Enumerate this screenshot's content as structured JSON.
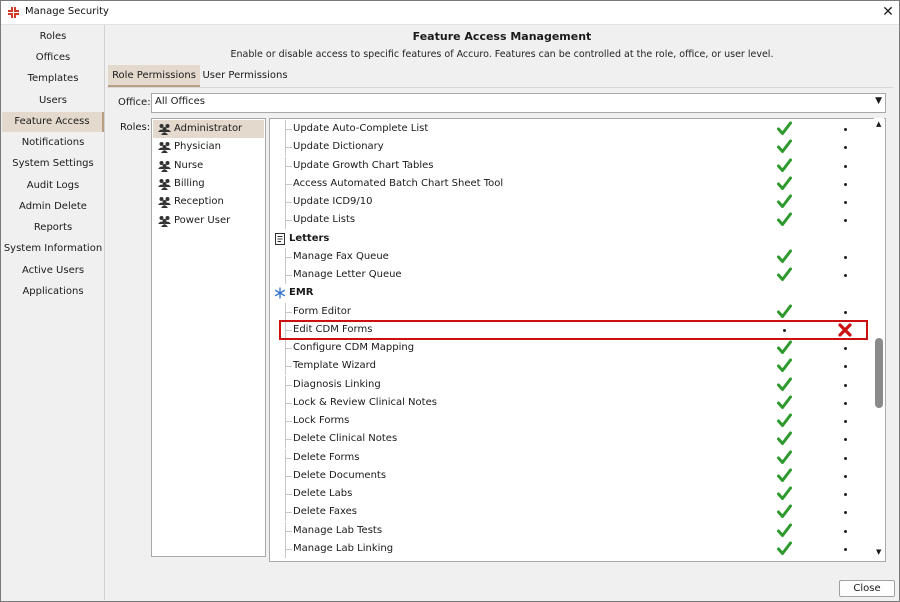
{
  "window": {
    "title": "Manage Security"
  },
  "sidebar": {
    "items": [
      {
        "label": "Roles"
      },
      {
        "label": "Offices"
      },
      {
        "label": "Templates"
      },
      {
        "label": "Users"
      },
      {
        "label": "Feature Access",
        "active": true
      },
      {
        "label": "Notifications"
      },
      {
        "label": "System Settings"
      },
      {
        "label": "Audit Logs"
      },
      {
        "label": "Admin Delete"
      },
      {
        "label": "Reports"
      },
      {
        "label": "System Information"
      },
      {
        "label": "Active Users"
      },
      {
        "label": "Applications"
      }
    ]
  },
  "header": {
    "title": "Feature Access Management",
    "description": "Enable or disable access to specific features of Accuro. Features can be controlled at the role, office, or user level."
  },
  "tabs": [
    {
      "label": "Role Permissions",
      "active": true
    },
    {
      "label": "User Permissions"
    }
  ],
  "office": {
    "label": "Office:",
    "value": "All Offices"
  },
  "roles": {
    "label": "Roles:",
    "items": [
      {
        "label": "Administrator",
        "selected": true
      },
      {
        "label": "Physician"
      },
      {
        "label": "Nurse"
      },
      {
        "label": "Billing"
      },
      {
        "label": "Reception"
      },
      {
        "label": "Power User"
      }
    ]
  },
  "features": [
    {
      "type": "item",
      "label": "Update Auto-Complete List",
      "allowed": true
    },
    {
      "type": "item",
      "label": "Update Dictionary",
      "allowed": true
    },
    {
      "type": "item",
      "label": "Update Growth Chart Tables",
      "allowed": true
    },
    {
      "type": "item",
      "label": "Access Automated Batch Chart Sheet Tool",
      "allowed": true
    },
    {
      "type": "item",
      "label": "Update ICD9/10",
      "allowed": true
    },
    {
      "type": "item",
      "label": "Update Lists",
      "allowed": true
    },
    {
      "type": "category",
      "label": "Letters",
      "icon": "letter-icon"
    },
    {
      "type": "item",
      "label": "Manage Fax Queue",
      "allowed": true
    },
    {
      "type": "item",
      "label": "Manage Letter Queue",
      "allowed": true
    },
    {
      "type": "category",
      "label": "EMR",
      "icon": "snowflake-icon"
    },
    {
      "type": "item",
      "label": "Form Editor",
      "allowed": true
    },
    {
      "type": "item",
      "label": "Edit CDM Forms",
      "allowed": false,
      "highlighted": true
    },
    {
      "type": "item",
      "label": "Configure CDM Mapping",
      "allowed": true
    },
    {
      "type": "item",
      "label": "Template Wizard",
      "allowed": true
    },
    {
      "type": "item",
      "label": "Diagnosis Linking",
      "allowed": true
    },
    {
      "type": "item",
      "label": "Lock & Review Clinical Notes",
      "allowed": true
    },
    {
      "type": "item",
      "label": "Lock Forms",
      "allowed": true
    },
    {
      "type": "item",
      "label": "Delete Clinical Notes",
      "allowed": true
    },
    {
      "type": "item",
      "label": "Delete Forms",
      "allowed": true
    },
    {
      "type": "item",
      "label": "Delete Documents",
      "allowed": true
    },
    {
      "type": "item",
      "label": "Delete Labs",
      "allowed": true
    },
    {
      "type": "item",
      "label": "Delete Faxes",
      "allowed": true
    },
    {
      "type": "item",
      "label": "Manage Lab Tests",
      "allowed": true
    },
    {
      "type": "item",
      "label": "Manage Lab Linking",
      "allowed": true
    }
  ],
  "footer": {
    "close_label": "Close"
  },
  "colors": {
    "active_bg": "#e3d9cc",
    "accent": "#b89f83",
    "check": "#2e9a2e",
    "deny": "#cc1010"
  }
}
